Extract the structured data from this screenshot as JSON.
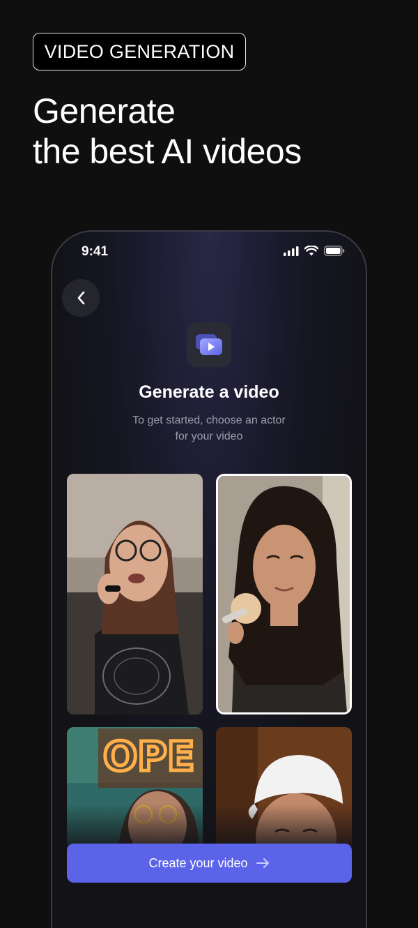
{
  "badge": {
    "label": "VIDEO GENERATION"
  },
  "headline": {
    "line1": "Generate",
    "line2": "the best AI videos"
  },
  "phone": {
    "status": {
      "time": "9:41",
      "icons": [
        "signal-icon",
        "wifi-icon",
        "battery-icon"
      ]
    },
    "back_icon": "chevron-left-icon",
    "app_icon": "video-play-icon",
    "title": "Generate a video",
    "subtitle_line1": "To get started, choose an actor",
    "subtitle_line2": "for your video",
    "actors": [
      {
        "name": "actor-card-1",
        "selected": false
      },
      {
        "name": "actor-card-2",
        "selected": true
      },
      {
        "name": "actor-card-3",
        "selected": false
      },
      {
        "name": "actor-card-4",
        "selected": false
      }
    ],
    "cta": {
      "label": "Create your video",
      "icon": "arrow-right-icon"
    }
  },
  "colors": {
    "background": "#0f0f10",
    "accent": "#5b63e8",
    "subtitle": "#9d9dab",
    "selected_border": "#ffffff"
  }
}
